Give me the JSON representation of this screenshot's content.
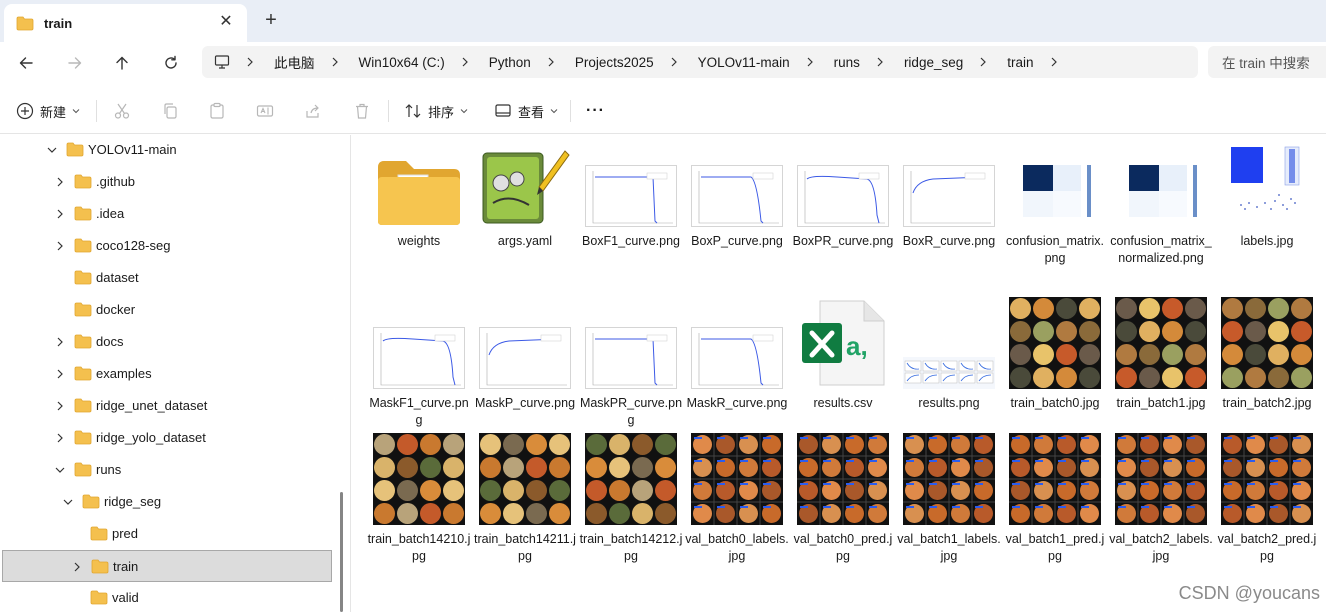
{
  "tab": {
    "title": "train",
    "close_glyph": "✕",
    "add_glyph": "+"
  },
  "breadcrumb": [
    "此电脑",
    "Win10x64 (C:)",
    "Python",
    "Projects2025",
    "YOLOv11-main",
    "runs",
    "ridge_seg",
    "train"
  ],
  "search": {
    "placeholder": "在 train 中搜索"
  },
  "toolbar": {
    "new_label": "新建",
    "sort_label": "排序",
    "view_label": "查看",
    "more_glyph": "···"
  },
  "tree": [
    {
      "label": "YOLOv11-main",
      "expanded": true,
      "level": 0,
      "has_children": true
    },
    {
      "label": ".github",
      "level": 1,
      "has_children": true
    },
    {
      "label": ".idea",
      "level": 1,
      "has_children": true
    },
    {
      "label": "coco128-seg",
      "level": 1,
      "has_children": true
    },
    {
      "label": "dataset",
      "level": 1,
      "has_children": false
    },
    {
      "label": "docker",
      "level": 1,
      "has_children": false
    },
    {
      "label": "docs",
      "level": 1,
      "has_children": true
    },
    {
      "label": "examples",
      "level": 1,
      "has_children": true
    },
    {
      "label": "ridge_unet_dataset",
      "level": 1,
      "has_children": true
    },
    {
      "label": "ridge_yolo_dataset",
      "level": 1,
      "has_children": true
    },
    {
      "label": "runs",
      "expanded": true,
      "level": 1,
      "has_children": true
    },
    {
      "label": "ridge_seg",
      "expanded": true,
      "level": 2,
      "has_children": true
    },
    {
      "label": "pred",
      "level": 3,
      "has_children": false
    },
    {
      "label": "train",
      "level": 3,
      "has_children": true,
      "selected": true
    },
    {
      "label": "valid",
      "level": 3,
      "has_children": false
    }
  ],
  "files": [
    {
      "name": "weights",
      "kind": "folder"
    },
    {
      "name": "args.yaml",
      "kind": "yaml"
    },
    {
      "name": "BoxF1_curve.png",
      "kind": "curve"
    },
    {
      "name": "BoxP_curve.png",
      "kind": "curve"
    },
    {
      "name": "BoxPR_curve.png",
      "kind": "curve"
    },
    {
      "name": "BoxR_curve.png",
      "kind": "curve"
    },
    {
      "name": "confusion_matrix.png",
      "kind": "confusion"
    },
    {
      "name": "confusion_matrix_normalized.png",
      "kind": "confusion"
    },
    {
      "name": "labels.jpg",
      "kind": "labels"
    },
    {
      "name": "MaskF1_curve.png",
      "kind": "curve"
    },
    {
      "name": "MaskP_curve.png",
      "kind": "curve"
    },
    {
      "name": "MaskPR_curve.png",
      "kind": "curve"
    },
    {
      "name": "MaskR_curve.png",
      "kind": "curve"
    },
    {
      "name": "results.csv",
      "kind": "csv"
    },
    {
      "name": "results.png",
      "kind": "results"
    },
    {
      "name": "train_batch0.jpg",
      "kind": "mosaic"
    },
    {
      "name": "train_batch1.jpg",
      "kind": "mosaic"
    },
    {
      "name": "train_batch2.jpg",
      "kind": "mosaic"
    },
    {
      "name": "train_batch14210.jpg",
      "kind": "mosaic2"
    },
    {
      "name": "train_batch14211.jpg",
      "kind": "mosaic2"
    },
    {
      "name": "train_batch14212.jpg",
      "kind": "mosaic2"
    },
    {
      "name": "val_batch0_labels.jpg",
      "kind": "val"
    },
    {
      "name": "val_batch0_pred.jpg",
      "kind": "val"
    },
    {
      "name": "val_batch1_labels.jpg",
      "kind": "val"
    },
    {
      "name": "val_batch1_pred.jpg",
      "kind": "val"
    },
    {
      "name": "val_batch2_labels.jpg",
      "kind": "val"
    },
    {
      "name": "val_batch2_pred.jpg",
      "kind": "val"
    }
  ],
  "watermark": "CSDN @youcans",
  "colors": {
    "folder": "#f4c04e",
    "folder_dark": "#e1a630",
    "excel": "#107c41",
    "selection": "#dcdcdc",
    "accent_blue": "#1f4fe0"
  }
}
